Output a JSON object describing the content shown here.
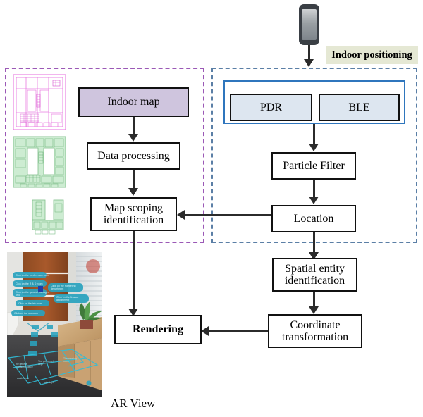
{
  "diagram": {
    "title": "Indoor AR navigation system workflow",
    "colors": {
      "map_region_border": "#9b59b6",
      "positioning_region_border": "#5b7fa6",
      "indoor_map_fill": "#cfc5de",
      "sensor_fill": "#dde6f0",
      "sensor_wrap_border": "#2f76bd",
      "tag_fill": "#e5e8d4",
      "connector": "#2b2b2b",
      "plan_pink": "#e05fd8",
      "plan_green": "#bfe6c4",
      "ar_overlay": "#2aa3bf"
    },
    "tag": {
      "label": "Indoor positioning"
    },
    "caption": {
      "ar_view": "AR View"
    },
    "map_branch": {
      "indoor_map": "Indoor map",
      "data_processing": "Data processing",
      "map_scoping": "Map scoping\nidentification",
      "map_scoping_line1": "Map scoping",
      "map_scoping_line2": "identification"
    },
    "positioning_branch": {
      "pdr": "PDR",
      "ble": "BLE",
      "particle_filter": "Particle Filter",
      "location": "Location"
    },
    "output_branch": {
      "spatial_entity_line1": "Spatial entity",
      "spatial_entity_line2": "identification",
      "coordinate_line1": "Coordinate",
      "coordinate_line2": "transformation",
      "rendering": "Rendering"
    },
    "icons": {
      "phone": "smartphone-icon",
      "plan_pink": "floor-plan-vector-icon",
      "plan_green_large": "floor-plan-rooms-icon",
      "plan_green_small": "floor-plan-partial-icon",
      "ar_photo": "ar-view-photo"
    }
  }
}
